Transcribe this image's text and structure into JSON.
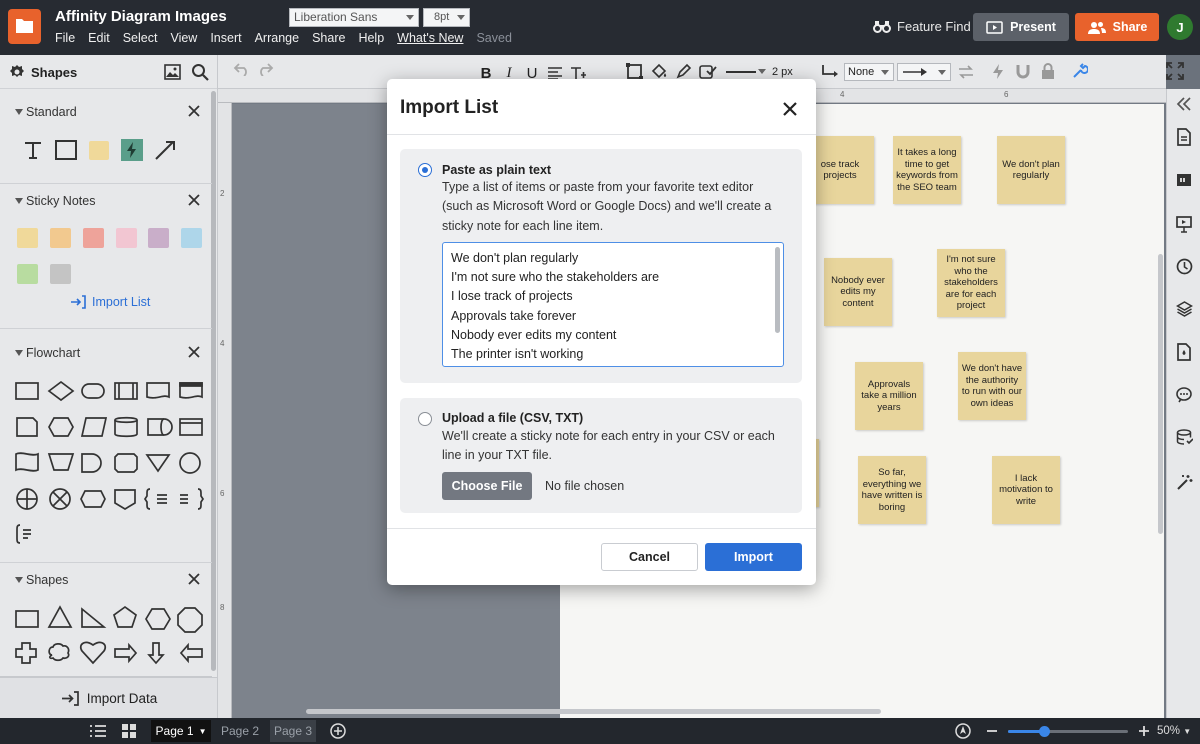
{
  "app": {
    "title": "Affinity Diagram Images",
    "menu": [
      "File",
      "Edit",
      "Select",
      "View",
      "Insert",
      "Arrange",
      "Share",
      "Help",
      "What's New",
      "Saved"
    ],
    "feature_find": "Feature Find",
    "present": "Present",
    "share": "Share",
    "avatar_initial": "J",
    "accent_color": "#e8622c"
  },
  "left_panel": {
    "title": "Shapes",
    "sections": {
      "standard": "Standard",
      "sticky_notes": "Sticky Notes",
      "flowchart": "Flowchart",
      "shapes": "Shapes"
    },
    "import_list": "Import List",
    "import_data": "Import Data",
    "sticky_colors": [
      "#f0d99a",
      "#f2c98f",
      "#eea39a",
      "#f2c6d2",
      "#c9aec9",
      "#aed6ea",
      "#b8dca0",
      "#c4c4c4"
    ]
  },
  "toolbar": {
    "font": "Liberation Sans",
    "font_size": "8pt",
    "line_width": "2 px",
    "line_end": "None"
  },
  "canvas": {
    "ruler_top": [
      "4",
      "6"
    ],
    "ruler_left": [
      "2",
      "4",
      "6",
      "8"
    ],
    "notes": [
      {
        "text": "I lose track of projects",
        "visible": "ose track projects"
      },
      {
        "text": "It takes a long time to get keywords from the SEO team"
      },
      {
        "text": "We don't plan regularly"
      },
      {
        "text": "Nobody ever edits my content"
      },
      {
        "text": "I'm not sure who the stakeholders are for each project"
      },
      {
        "text": "Approvals take a million years"
      },
      {
        "text": "We don't have the authority to run with our own ideas"
      },
      {
        "text": "So far, everything we have written is boring"
      },
      {
        "text": "I lack motivation to write"
      }
    ]
  },
  "modal": {
    "title": "Import List",
    "option1": {
      "title": "Paste as plain text",
      "description": "Type a list of items or paste from your favorite text editor (such as Microsoft Word or Google Docs) and we'll create a sticky note for each line item.",
      "lines": [
        "We don't plan regularly",
        "I'm not sure who the stakeholders are",
        "I lose track of projects",
        "Approvals take forever",
        "Nobody ever edits my content",
        "The printer isn't working"
      ],
      "selected": true
    },
    "option2": {
      "title": "Upload a file (CSV, TXT)",
      "description": "We'll create a sticky note for each entry in your CSV or each line in your TXT file.",
      "choose_file": "Choose File",
      "no_file": "No file chosen",
      "selected": false
    },
    "cancel": "Cancel",
    "import": "Import"
  },
  "bottom_bar": {
    "pages": [
      "Page 1",
      "Page 2",
      "Page 3"
    ],
    "zoom": "50%",
    "zoom_fraction": 0.3
  }
}
